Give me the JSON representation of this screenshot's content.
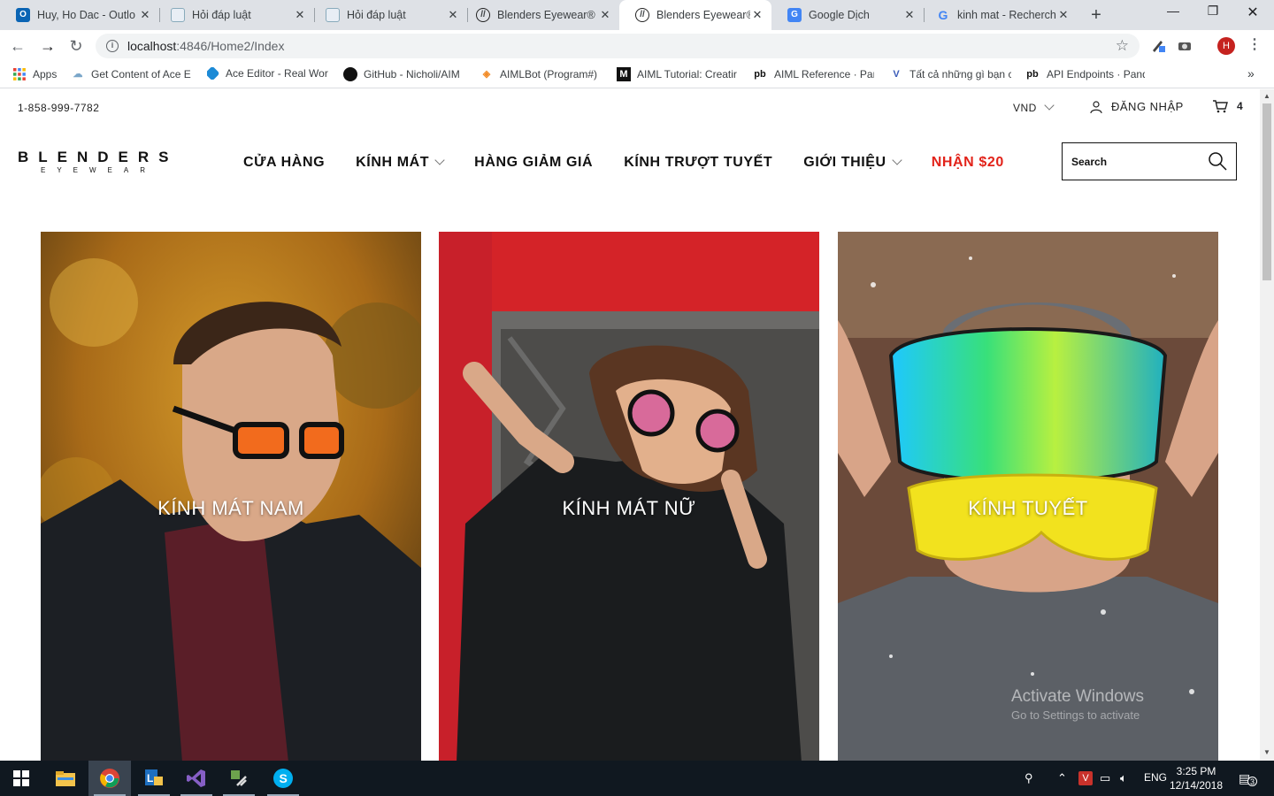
{
  "browser": {
    "tabs": [
      {
        "title": "Huy, Ho Dac - Outlo",
        "icon": "outlook-icon",
        "active": false
      },
      {
        "title": "Hỏi đáp luật",
        "icon": "page-icon",
        "active": false
      },
      {
        "title": "Hỏi đáp luật",
        "icon": "page-icon",
        "active": false
      },
      {
        "title": "Blenders Eyewear®",
        "icon": "blenders-icon",
        "active": false
      },
      {
        "title": "Blenders Eyewear®",
        "icon": "blenders-icon",
        "active": true
      },
      {
        "title": "Google Dịch",
        "icon": "google-translate-icon",
        "active": false
      },
      {
        "title": "kinh mat - Recherch",
        "icon": "google-icon",
        "active": false
      }
    ],
    "url_host": "localhost",
    "url_path": ":4846/Home2/Index",
    "profile_initial": "H",
    "bookmarks": [
      {
        "label": "Apps",
        "icon": "apps-grid-icon"
      },
      {
        "label": "Get Content of Ace E",
        "icon": "cloud-icon"
      },
      {
        "label": "Ace Editor - Real Wor",
        "icon": "ace-icon"
      },
      {
        "label": "GitHub - Nicholi/AIM",
        "icon": "github-icon"
      },
      {
        "label": "AIMLBot (Program#)",
        "icon": "aimlbot-icon"
      },
      {
        "label": "AIML Tutorial: Creatir",
        "icon": "medium-icon"
      },
      {
        "label": "AIML Reference · Pan",
        "icon": "pandorabots-icon"
      },
      {
        "label": "Tất cả những gì bạn c",
        "icon": "v-icon"
      },
      {
        "label": "API Endpoints · Pand",
        "icon": "pandorabots-icon"
      }
    ]
  },
  "site": {
    "phone": "1-858-999-7782",
    "currency": "VND",
    "login": "ĐĂNG NHẬP",
    "cart_count": "4",
    "logo_top": "BLENDERS",
    "logo_bottom": "EYEWEAR",
    "nav": [
      {
        "label": "CỬA HÀNG",
        "dropdown": false,
        "promo": false
      },
      {
        "label": "KÍNH MÁT",
        "dropdown": true,
        "promo": false
      },
      {
        "label": "HÀNG GIẢM GIÁ",
        "dropdown": false,
        "promo": false
      },
      {
        "label": "KÍNH TRƯỢT TUYẾT",
        "dropdown": false,
        "promo": false
      },
      {
        "label": "GIỚI THIỆU",
        "dropdown": true,
        "promo": false
      },
      {
        "label": "NHẬN $20",
        "dropdown": false,
        "promo": true
      }
    ],
    "search_placeholder": "Search",
    "tiles": [
      {
        "label": "KÍNH MÁT NAM",
        "photo": "man-in-sunglasses-autumn"
      },
      {
        "label": "KÍNH MÁT NỮ",
        "photo": "woman-in-sunglasses-peace-sign"
      },
      {
        "label": "KÍNH TUYẾT",
        "photo": "man-in-ski-goggles-snow"
      }
    ],
    "accent_color": "#e2231a"
  },
  "watermark": {
    "line1": "Activate Windows",
    "line2": "Go to Settings to activate"
  },
  "taskbar": {
    "apps": [
      "windows-start-icon",
      "file-explorer-icon",
      "chrome-icon",
      "lync-icon",
      "visual-studio-icon",
      "tool-icon",
      "skype-icon"
    ],
    "language": "ENG",
    "time": "3:25 PM",
    "date": "12/14/2018",
    "notification_count": "3"
  }
}
